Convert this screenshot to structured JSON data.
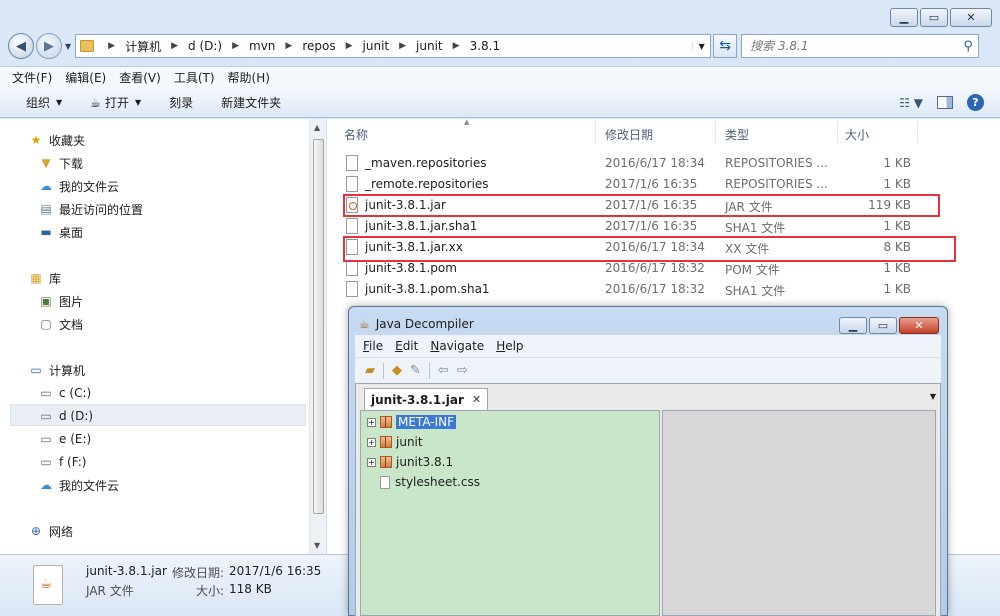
{
  "explorer": {
    "breadcrumb": [
      "计算机",
      "d (D:)",
      "mvn",
      "repos",
      "junit",
      "junit",
      "3.8.1"
    ],
    "search_placeholder": "搜索 3.8.1",
    "menu": [
      "文件(F)",
      "编辑(E)",
      "查看(V)",
      "工具(T)",
      "帮助(H)"
    ],
    "toolbar": {
      "organize": "组织",
      "open": "打开",
      "burn": "刻录",
      "new_folder": "新建文件夹"
    },
    "sidebar": {
      "favorites": "收藏夹",
      "favorites_items": [
        "下载",
        "我的文件云",
        "最近访问的位置",
        "桌面"
      ],
      "libraries": "库",
      "libraries_items": [
        "图片",
        "文档"
      ],
      "computer": "计算机",
      "computer_items": [
        "c (C:)",
        "d (D:)",
        "e (E:)",
        "f (F:)",
        "我的文件云"
      ],
      "network": "网络"
    },
    "columns": {
      "name": "名称",
      "modified": "修改日期",
      "type": "类型",
      "size": "大小"
    },
    "files": [
      {
        "name": "_maven.repositories",
        "modified": "2016/6/17 18:34",
        "type": "REPOSITORIES ...",
        "size": "1 KB"
      },
      {
        "name": "_remote.repositories",
        "modified": "2017/1/6 16:35",
        "type": "REPOSITORIES ...",
        "size": "1 KB"
      },
      {
        "name": "junit-3.8.1.jar",
        "modified": "2017/1/6 16:35",
        "type": "JAR 文件",
        "size": "119 KB"
      },
      {
        "name": "junit-3.8.1.jar.sha1",
        "modified": "2017/1/6 16:35",
        "type": "SHA1 文件",
        "size": "1 KB"
      },
      {
        "name": "junit-3.8.1.jar.xx",
        "modified": "2016/6/17 18:34",
        "type": "XX 文件",
        "size": "8 KB"
      },
      {
        "name": "junit-3.8.1.pom",
        "modified": "2016/6/17 18:32",
        "type": "POM 文件",
        "size": "1 KB"
      },
      {
        "name": "junit-3.8.1.pom.sha1",
        "modified": "2016/6/17 18:32",
        "type": "SHA1 文件",
        "size": "1 KB"
      }
    ],
    "details": {
      "name": "junit-3.8.1.jar",
      "type": "JAR 文件",
      "modified_label": "修改日期:",
      "modified_value": "2017/1/6 16:35",
      "size_label": "大小:",
      "size_value": "118 KB"
    },
    "highlight_color": "#e4343b"
  },
  "decompiler": {
    "title": "Java Decompiler",
    "menu": [
      {
        "key": "F",
        "rest": "ile"
      },
      {
        "key": "E",
        "rest": "dit"
      },
      {
        "key": "N",
        "rest": "avigate"
      },
      {
        "key": "H",
        "rest": "elp"
      }
    ],
    "tab": "junit-3.8.1.jar",
    "tree": [
      "META-INF",
      "junit",
      "junit3.8.1",
      "stylesheet.css"
    ],
    "tree_bg": "#c9e6c9"
  }
}
